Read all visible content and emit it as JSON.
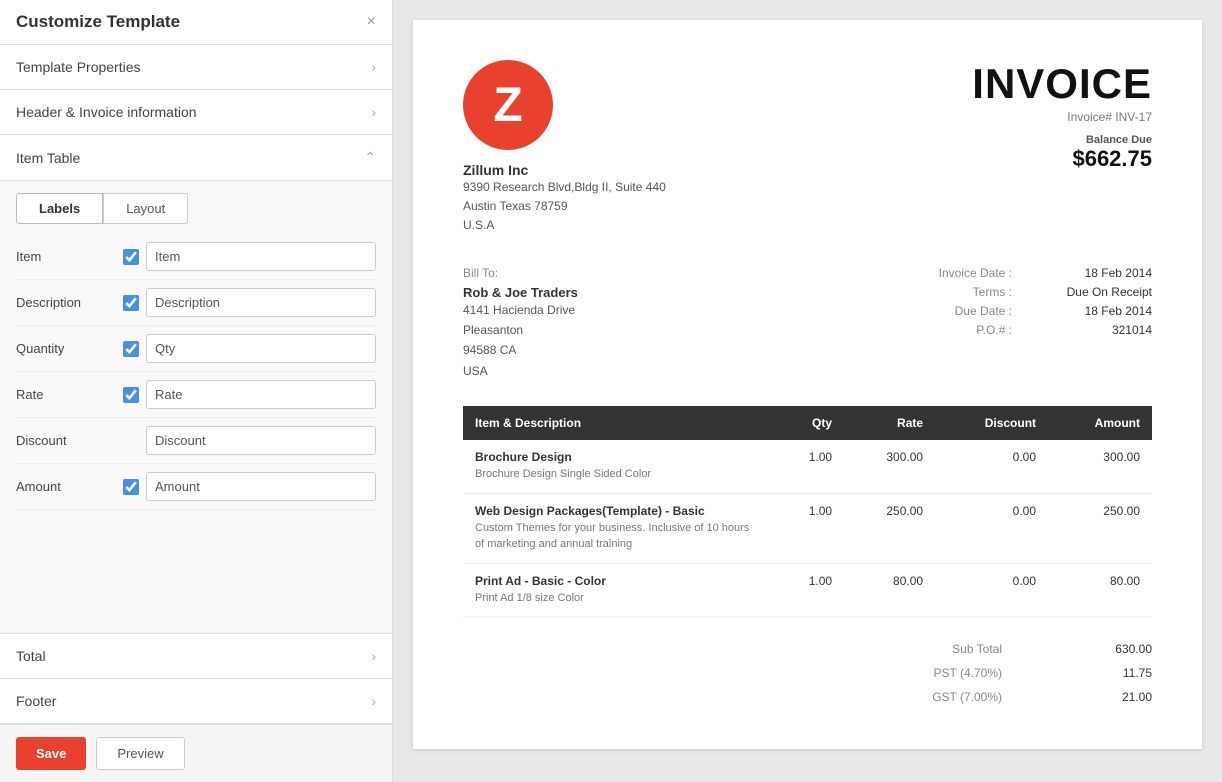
{
  "panel": {
    "title": "Customize Template",
    "close_label": "×"
  },
  "sections": {
    "template_properties": {
      "label": "Template Properties"
    },
    "header_invoice": {
      "label": "Header & Invoice information"
    },
    "item_table": {
      "label": "Item Table"
    },
    "total": {
      "label": "Total"
    },
    "footer": {
      "label": "Footer"
    }
  },
  "item_table_tabs": {
    "labels": "Labels",
    "layout": "Layout"
  },
  "fields": [
    {
      "id": "item",
      "label": "Item",
      "checked": true,
      "value": "Item"
    },
    {
      "id": "description",
      "label": "Description",
      "checked": true,
      "value": "Description"
    },
    {
      "id": "quantity",
      "label": "Quantity",
      "checked": true,
      "value": "Qty"
    },
    {
      "id": "rate",
      "label": "Rate",
      "checked": true,
      "value": "Rate"
    },
    {
      "id": "discount",
      "label": "Discount",
      "checked": false,
      "value": "Discount"
    },
    {
      "id": "amount",
      "label": "Amount",
      "checked": true,
      "value": "Amount"
    }
  ],
  "buttons": {
    "save": "Save",
    "preview": "Preview"
  },
  "invoice": {
    "logo_letter": "Z",
    "title": "INVOICE",
    "invoice_number": "Invoice# INV-17",
    "balance_due_label": "Balance Due",
    "balance_due_amount": "$662.75",
    "company": {
      "name": "Zillum Inc",
      "address_line1": "9390 Research Blvd,Bldg II, Suite 440",
      "address_line2": "Austin Texas 78759",
      "address_line3": "U.S.A"
    },
    "bill_to": {
      "label": "Bill To:",
      "name": "Rob & Joe Traders",
      "address_line1": "4141 Hacienda Drive",
      "address_line2": "Pleasanton",
      "address_line3": "94588 CA",
      "address_line4": "USA"
    },
    "details": [
      {
        "label": "Invoice Date :",
        "value": "18 Feb 2014"
      },
      {
        "label": "Terms :",
        "value": "Due On Receipt"
      },
      {
        "label": "Due Date :",
        "value": "18 Feb 2014"
      },
      {
        "label": "P.O.# :",
        "value": "321014"
      }
    ],
    "table_headers": [
      {
        "key": "desc",
        "label": "Item & Description"
      },
      {
        "key": "qty",
        "label": "Qty"
      },
      {
        "key": "rate",
        "label": "Rate"
      },
      {
        "key": "discount",
        "label": "Discount"
      },
      {
        "key": "amount",
        "label": "Amount"
      }
    ],
    "line_items": [
      {
        "name": "Brochure Design",
        "description": "Brochure Design Single Sided Color",
        "qty": "1.00",
        "rate": "300.00",
        "discount": "0.00",
        "amount": "300.00"
      },
      {
        "name": "Web Design Packages(Template) - Basic",
        "description": "Custom Themes for your business. Inclusive of 10 hours of marketing and annual training",
        "qty": "1.00",
        "rate": "250.00",
        "discount": "0.00",
        "amount": "250.00"
      },
      {
        "name": "Print Ad - Basic - Color",
        "description": "Print Ad 1/8 size Color",
        "qty": "1.00",
        "rate": "80.00",
        "discount": "0.00",
        "amount": "80.00"
      }
    ],
    "totals": [
      {
        "label": "Sub Total",
        "value": "630.00"
      },
      {
        "label": "PST (4.70%)",
        "value": "11.75"
      },
      {
        "label": "GST (7.00%)",
        "value": "21.00"
      }
    ]
  }
}
